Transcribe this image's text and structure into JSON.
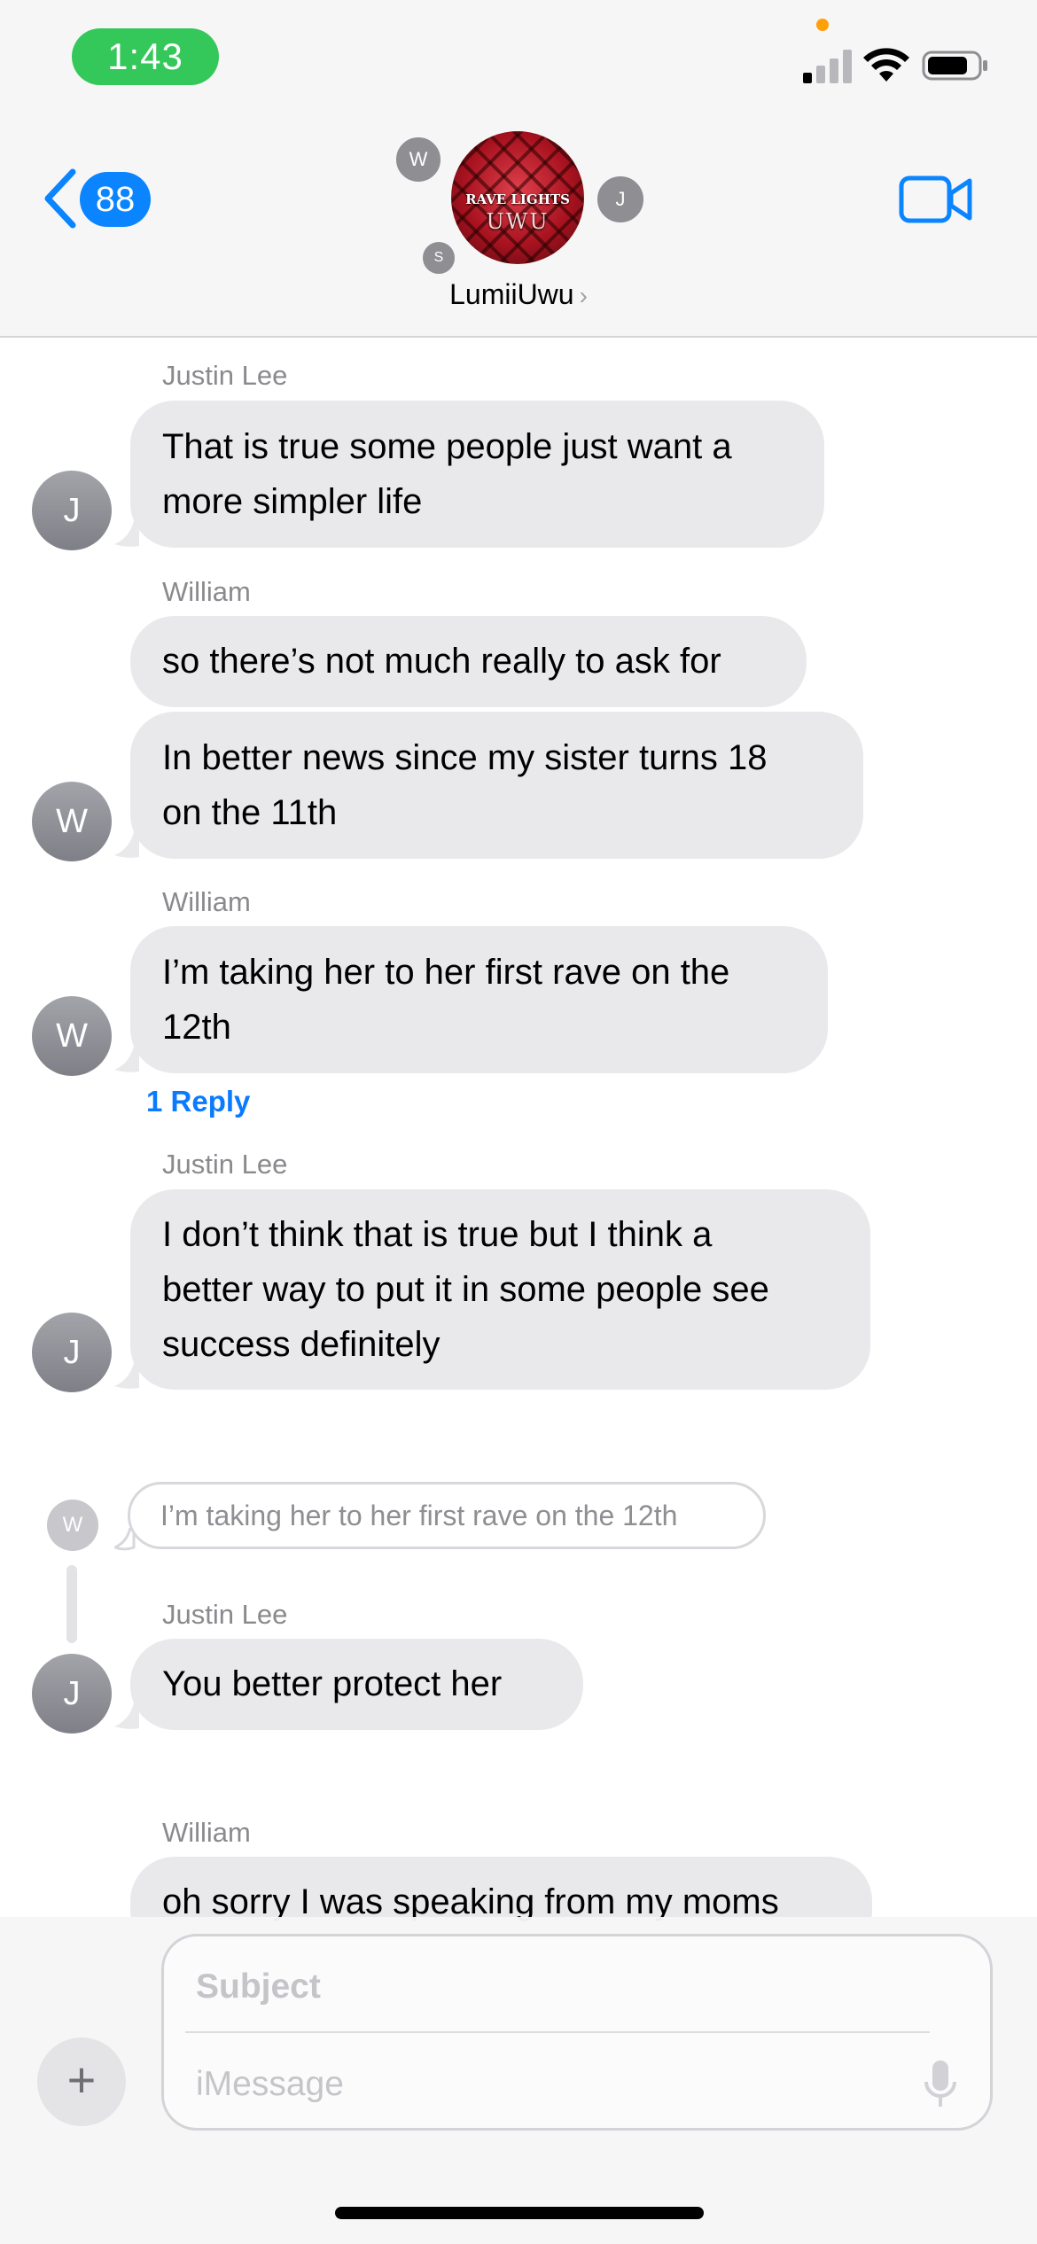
{
  "status_bar": {
    "time": "1:43",
    "colors": {
      "time_pill": "#34c759",
      "privacy_dot": "#ff9f0a"
    },
    "signal_icon": "cellular-signal-icon",
    "wifi_icon": "wifi-icon",
    "battery_icon": "battery-icon"
  },
  "header": {
    "back_count": "88",
    "group_name": "LumiiUwu",
    "chevron": "›",
    "avatar_text_line1": "RAVE LIGHTS",
    "avatar_text_line2": "UWU",
    "member_initials": {
      "w": "W",
      "j": "J",
      "s": "S"
    },
    "video_icon": "video-camera-icon",
    "accent_color": "#0a84ff"
  },
  "messages": [
    {
      "sender": "Justin Lee",
      "initial": "J",
      "text": "That is true some people just want a\nmore simpler life"
    },
    {
      "sender": "William",
      "initial": "W",
      "texts": [
        "so there’s not much really to ask for",
        "In better news since my sister turns 18\non the 11th"
      ]
    },
    {
      "sender": "William",
      "initial": "W",
      "text": "I’m taking her to her first rave on the\n12th",
      "reply_label": "1 Reply"
    },
    {
      "sender": "Justin Lee",
      "initial": "J",
      "text": "I don’t think that is true but I think a\nbetter way to put it in some people see\nsuccess definitely"
    },
    {
      "quoted_initial": "W",
      "quoted_text": "I’m taking her to her first rave on the 12th"
    },
    {
      "sender": "Justin Lee",
      "initial": "J",
      "text": "You better protect her"
    },
    {
      "sender": "William",
      "text": "oh sorry I was speaking from my moms"
    }
  ],
  "composer": {
    "subject_placeholder": "Subject",
    "message_placeholder": "iMessage",
    "plus_label": "+",
    "mic_icon": "microphone-icon"
  }
}
